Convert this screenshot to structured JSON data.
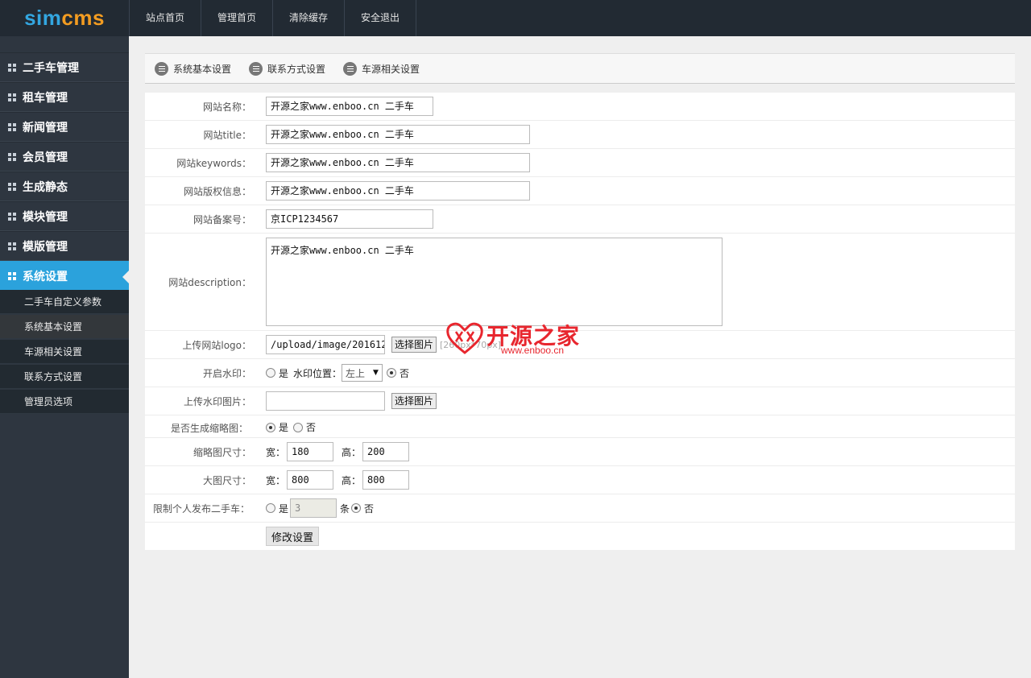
{
  "logo": {
    "part1": "sim",
    "part2": "cms"
  },
  "topnav": [
    "站点首页",
    "管理首页",
    "清除缓存",
    "安全退出"
  ],
  "sidebar": {
    "groups": [
      "二手车管理",
      "租车管理",
      "新闻管理",
      "会员管理",
      "生成静态",
      "模块管理",
      "模版管理",
      "系统设置"
    ],
    "subitems": [
      "二手车自定义参数",
      "系统基本设置",
      "车源相关设置",
      "联系方式设置",
      "管理员选项"
    ],
    "active_group": "系统设置",
    "current_subitem": "系统基本设置"
  },
  "tabs": [
    "系统基本设置",
    "联系方式设置",
    "车源相关设置"
  ],
  "form": {
    "site_name": {
      "label": "网站名称：",
      "value": "开源之家www.enboo.cn 二手车"
    },
    "site_title": {
      "label": "网站title：",
      "value": "开源之家www.enboo.cn 二手车"
    },
    "site_keywords": {
      "label": "网站keywords：",
      "value": "开源之家www.enboo.cn 二手车"
    },
    "copyright": {
      "label": "网站版权信息：",
      "value": "开源之家www.enboo.cn 二手车"
    },
    "icp": {
      "label": "网站备案号：",
      "value": "京ICP1234567"
    },
    "description": {
      "label": "网站description：",
      "value": "开源之家www.enboo.cn 二手车"
    },
    "logo_upload": {
      "label": "上传网站logo：",
      "value": "/upload/image/201612",
      "button": "选择图片",
      "hint": "[260px*70px]"
    },
    "watermark": {
      "label": "开启水印：",
      "yes": "是",
      "position_label": "水印位置：",
      "position_value": "左上",
      "no": "否",
      "selected": "否"
    },
    "watermark_image": {
      "label": "上传水印图片：",
      "value": "",
      "button": "选择图片"
    },
    "thumbnail": {
      "label": "是否生成缩略图：",
      "yes": "是",
      "no": "否",
      "selected": "是"
    },
    "thumb_size": {
      "label": "缩略图尺寸：",
      "width_label": "宽：",
      "width": "180",
      "height_label": "高：",
      "height": "200"
    },
    "large_size": {
      "label": "大图尺寸：",
      "width_label": "宽：",
      "width": "800",
      "height_label": "高：",
      "height": "800"
    },
    "limit_publish": {
      "label": "限制个人发布二手车：",
      "yes": "是",
      "count": "3",
      "unit": "条",
      "no": "否",
      "selected": "否"
    },
    "submit": "修改设置"
  },
  "watermark_overlay": {
    "text": "开源之家",
    "url": "www.enboo.cn"
  },
  "colors": {
    "topbar": "#222a33",
    "sidebar": "#2e3640",
    "active": "#2ba2dc",
    "logo_blue": "#33a6e0",
    "logo_orange": "#f39c21",
    "watermark": "#e8262e"
  }
}
